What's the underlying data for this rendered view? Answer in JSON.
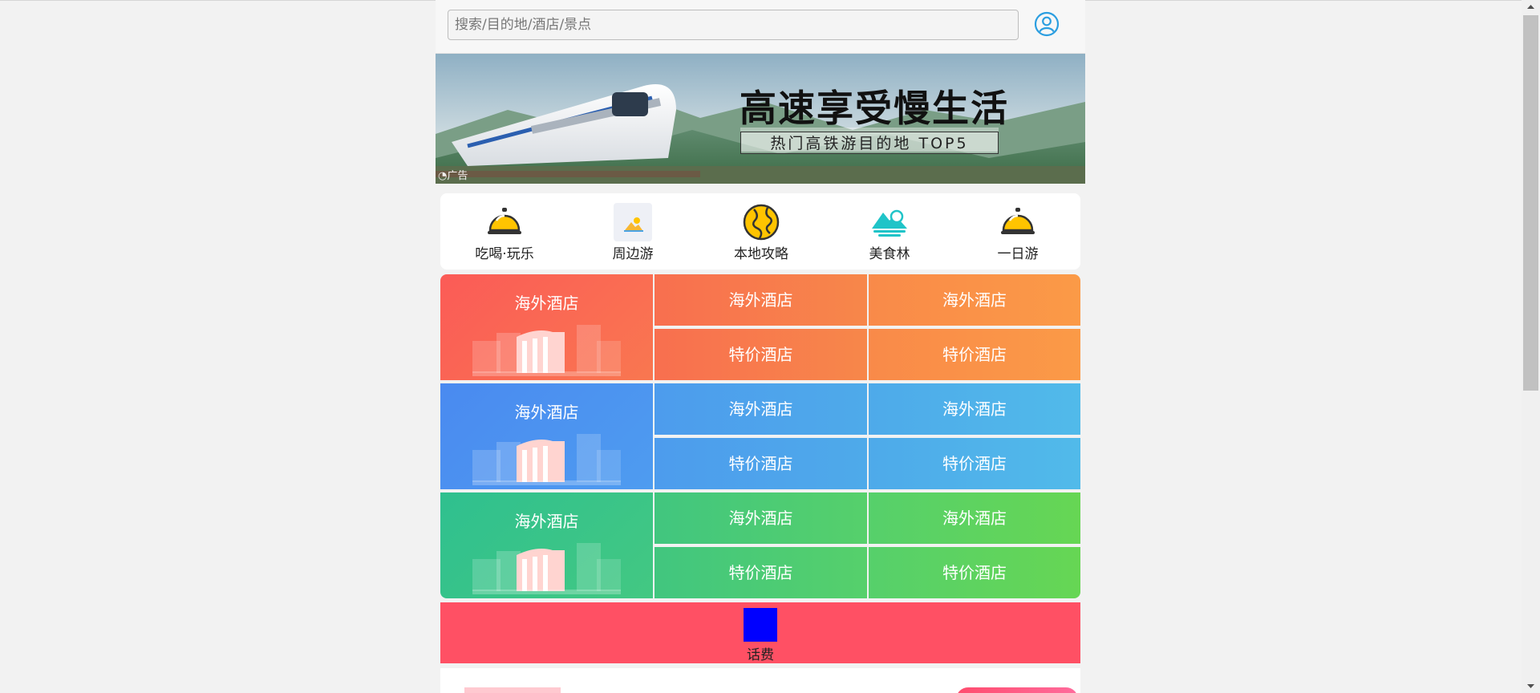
{
  "header": {
    "search_placeholder": "搜索/目的地/酒店/景点",
    "avatar_icon": "user-circle-icon"
  },
  "banner": {
    "title": "高速享受慢生活",
    "subtitle": "热门高铁游目的地 TOP5",
    "ad_label": "广告"
  },
  "categories": [
    {
      "label": "吃喝·玩乐",
      "icon": "dining-bell-icon"
    },
    {
      "label": "周边游",
      "icon": "landscape-photo-icon"
    },
    {
      "label": "本地攻略",
      "icon": "map-route-icon"
    },
    {
      "label": "美食林",
      "icon": "mountain-lake-icon"
    },
    {
      "label": "一日游",
      "icon": "dining-bell-icon"
    }
  ],
  "sections": [
    {
      "big": "海外酒店",
      "top": [
        "海外酒店",
        "海外酒店"
      ],
      "bottom": [
        "特价酒店",
        "特价酒店"
      ]
    },
    {
      "big": "海外酒店",
      "top": [
        "海外酒店",
        "海外酒店"
      ],
      "bottom": [
        "特价酒店",
        "特价酒店"
      ]
    },
    {
      "big": "海外酒店",
      "top": [
        "海外酒店",
        "海外酒店"
      ],
      "bottom": [
        "特价酒店",
        "特价酒店"
      ]
    }
  ],
  "recharge": {
    "label": "话费"
  },
  "colors": {
    "accent_red": "#ff5064",
    "orange_grad": "#fb5f55",
    "blue_grad": "#4a8af0",
    "green_grad": "#2fc08f"
  }
}
